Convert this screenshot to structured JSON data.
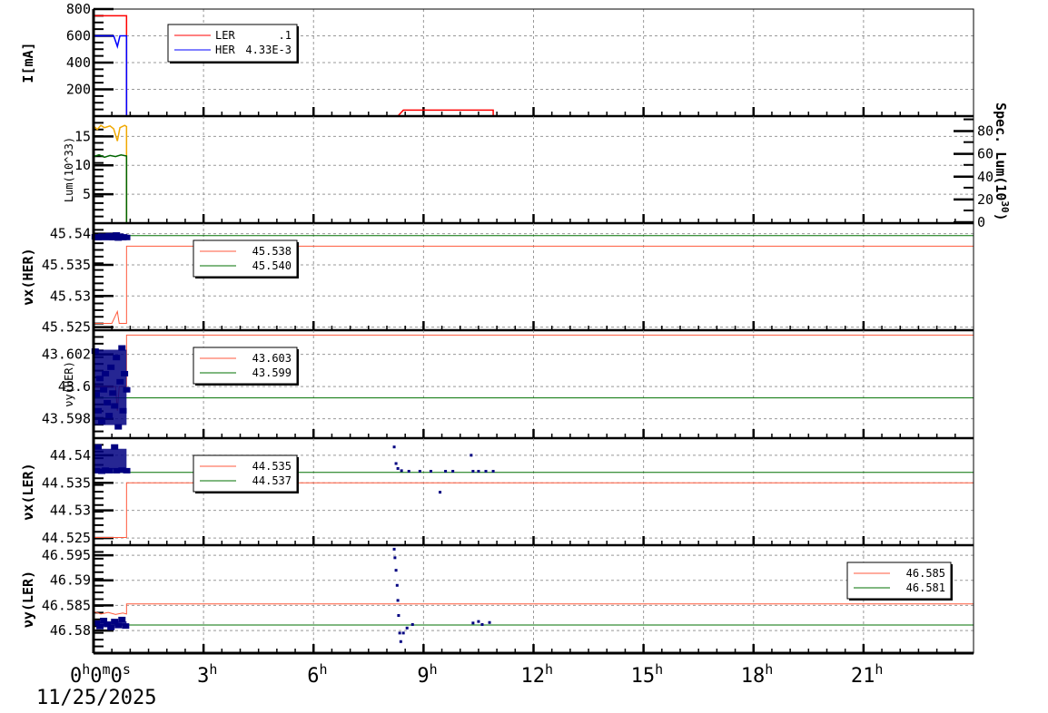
{
  "chart_data": [
    {
      "type": "line",
      "ylabel": "I[mA]",
      "ylim": [
        0,
        800
      ],
      "yticks": [
        200,
        400,
        600,
        800
      ],
      "ytick_labels": [
        "200",
        "400",
        "600",
        "800"
      ],
      "legend": {
        "placement": "top-left",
        "entries": [
          {
            "name": "LER",
            "value": ".1",
            "color": "#ff0000"
          },
          {
            "name": "HER",
            "value": "4.33E-3",
            "color": "#0000ff"
          }
        ]
      },
      "series": [
        {
          "name": "LER",
          "color": "#ff0000",
          "points": [
            [
              0,
              750
            ],
            [
              0.9,
              750
            ],
            [
              0.9,
              0
            ],
            [
              8.3,
              0
            ],
            [
              8.45,
              45
            ],
            [
              10.9,
              45
            ],
            [
              10.9,
              0
            ],
            [
              24,
              0
            ]
          ]
        },
        {
          "name": "HER",
          "color": "#0000ff",
          "points": [
            [
              0,
              600
            ],
            [
              0.55,
              600
            ],
            [
              0.65,
              520
            ],
            [
              0.72,
              600
            ],
            [
              0.9,
              600
            ],
            [
              0.9,
              0
            ],
            [
              24,
              0
            ]
          ]
        }
      ]
    },
    {
      "type": "line",
      "ylabel": "Lum(10^33)",
      "ylim": [
        0,
        18.5
      ],
      "yticks": [
        5,
        10,
        15
      ],
      "ytick_labels": [
        "5",
        "10",
        "15"
      ],
      "y2label": "Spec. Lum(10^30)",
      "y2lim": [
        0,
        90
      ],
      "y2ticks": [
        0,
        20,
        40,
        60,
        80
      ],
      "y2tick_labels": [
        "0",
        "20",
        "40",
        "60",
        "80"
      ],
      "series": [
        {
          "name": "Lum",
          "color": "#f0a800",
          "points": [
            [
              0,
              16.8
            ],
            [
              0.1,
              16.2
            ],
            [
              0.2,
              16.9
            ],
            [
              0.3,
              16.5
            ],
            [
              0.45,
              16.8
            ],
            [
              0.55,
              16.3
            ],
            [
              0.65,
              14.2
            ],
            [
              0.72,
              16.5
            ],
            [
              0.85,
              16.9
            ],
            [
              0.9,
              16.7
            ],
            [
              0.9,
              0
            ]
          ]
        },
        {
          "name": "Spec. Lum",
          "color": "#006400",
          "points": [
            [
              0,
              11.5
            ],
            [
              0.15,
              11.8
            ],
            [
              0.3,
              11.4
            ],
            [
              0.45,
              11.7
            ],
            [
              0.6,
              11.5
            ],
            [
              0.75,
              11.8
            ],
            [
              0.9,
              11.6
            ],
            [
              0.9,
              0
            ]
          ]
        }
      ]
    },
    {
      "type": "scatter",
      "ylabel": "νx(HER)",
      "ylim": [
        45.5245,
        45.5417
      ],
      "yticks": [
        45.525,
        45.53,
        45.535,
        45.54
      ],
      "ytick_labels": [
        "45.525",
        "45.53",
        "45.535",
        "45.54"
      ],
      "legend": {
        "placement": "top-left",
        "entries": [
          {
            "name": "",
            "value": "45.538",
            "color": "#ff5a3c"
          },
          {
            "name": "",
            "value": "45.540",
            "color": "#007000"
          }
        ]
      },
      "series": [
        {
          "name": "set",
          "color": "#ff5a3c",
          "points": [
            [
              0,
              45.5256
            ],
            [
              0.5,
              45.5256
            ],
            [
              0.65,
              45.5275
            ],
            [
              0.7,
              45.5256
            ],
            [
              0.9,
              45.5256
            ],
            [
              0.9,
              45.538
            ],
            [
              24,
              45.538
            ]
          ]
        },
        {
          "name": "ref",
          "color": "#007000",
          "points": [
            [
              0,
              45.5397
            ],
            [
              24,
              45.5397
            ]
          ]
        },
        {
          "name": "meas",
          "color": "#000080",
          "dots": [
            [
              0.02,
              45.5395
            ],
            [
              0.1,
              45.5394
            ],
            [
              0.2,
              45.5396
            ],
            [
              0.3,
              45.5395
            ],
            [
              0.4,
              45.5397
            ],
            [
              0.5,
              45.5394
            ],
            [
              0.6,
              45.5398
            ],
            [
              0.65,
              45.5393
            ],
            [
              0.7,
              45.5396
            ],
            [
              0.8,
              45.5395
            ],
            [
              0.88,
              45.5394
            ]
          ]
        }
      ]
    },
    {
      "type": "scatter",
      "ylabel": "νy(HER)",
      "ylim": [
        43.5968,
        43.6035
      ],
      "yticks": [
        43.598,
        43.6,
        43.602
      ],
      "ytick_labels": [
        "43.598",
        "43.6",
        "43.602"
      ],
      "legend": {
        "placement": "top-left",
        "entries": [
          {
            "name": "",
            "value": "43.603",
            "color": "#ff5a3c"
          },
          {
            "name": "",
            "value": "43.599",
            "color": "#007000"
          }
        ]
      },
      "series": [
        {
          "name": "set",
          "color": "#ff5a3c",
          "points": [
            [
              0,
              43.6
            ],
            [
              0.6,
              43.6
            ],
            [
              0.65,
              43.5985
            ],
            [
              0.7,
              43.6
            ],
            [
              0.9,
              43.6
            ],
            [
              0.9,
              43.6032
            ],
            [
              24,
              43.6032
            ]
          ]
        },
        {
          "name": "ref",
          "color": "#007000",
          "points": [
            [
              0,
              43.5993
            ],
            [
              24,
              43.5993
            ]
          ]
        },
        {
          "name": "meas",
          "color": "#000080",
          "dots": [
            [
              0.02,
              43.6022
            ],
            [
              0.05,
              43.5995
            ],
            [
              0.1,
              43.5985
            ],
            [
              0.15,
              43.6005
            ],
            [
              0.2,
              43.5978
            ],
            [
              0.25,
              43.5998
            ],
            [
              0.3,
              43.6008
            ],
            [
              0.35,
              43.599
            ],
            [
              0.4,
              43.5982
            ],
            [
              0.45,
              43.6012
            ],
            [
              0.5,
              43.5996
            ],
            [
              0.55,
              43.5988
            ],
            [
              0.6,
              43.6018
            ],
            [
              0.65,
              43.5975
            ],
            [
              0.7,
              43.6003
            ],
            [
              0.75,
              43.6024
            ],
            [
              0.78,
              43.5985
            ],
            [
              0.82,
              43.6008
            ],
            [
              0.88,
              43.5998
            ]
          ]
        }
      ]
    },
    {
      "type": "scatter",
      "ylabel": "νx(LER)",
      "ylim": [
        44.5237,
        44.5431
      ],
      "yticks": [
        44.525,
        44.53,
        44.535,
        44.54
      ],
      "ytick_labels": [
        "44.525",
        "44.53",
        "44.535",
        "44.54"
      ],
      "legend": {
        "placement": "top-left",
        "entries": [
          {
            "name": "",
            "value": "44.535",
            "color": "#ff5a3c"
          },
          {
            "name": "",
            "value": "44.537",
            "color": "#007000"
          }
        ]
      },
      "series": [
        {
          "name": "set",
          "color": "#ff5a3c",
          "points": [
            [
              0,
              44.5251
            ],
            [
              0.9,
              44.5251
            ],
            [
              0.9,
              44.535
            ],
            [
              24,
              44.535
            ]
          ]
        },
        {
          "name": "ref",
          "color": "#007000",
          "points": [
            [
              0,
              44.5369
            ],
            [
              24,
              44.5369
            ]
          ]
        },
        {
          "name": "meas",
          "color": "#000080",
          "dots": [
            [
              0.05,
              44.5372
            ],
            [
              0.1,
              44.5415
            ],
            [
              0.2,
              44.5371
            ],
            [
              0.3,
              44.5373
            ],
            [
              0.4,
              44.5372
            ],
            [
              0.55,
              44.5415
            ],
            [
              0.6,
              44.5372
            ],
            [
              0.75,
              44.5373
            ],
            [
              0.88,
              44.5372
            ],
            [
              8.2,
              44.5415
            ],
            [
              8.25,
              44.5385
            ],
            [
              8.3,
              44.5376
            ],
            [
              8.4,
              44.5372
            ],
            [
              8.6,
              44.5371
            ],
            [
              8.9,
              44.5371
            ],
            [
              9.2,
              44.5371
            ],
            [
              9.45,
              44.5333
            ],
            [
              9.6,
              44.5371
            ],
            [
              9.8,
              44.5371
            ],
            [
              10.3,
              44.54
            ],
            [
              10.35,
              44.5371
            ],
            [
              10.5,
              44.5371
            ],
            [
              10.7,
              44.5371
            ],
            [
              10.9,
              44.5371
            ]
          ]
        }
      ]
    },
    {
      "type": "scatter",
      "ylabel": "νy(LER)",
      "ylim": [
        46.5755,
        46.597
      ],
      "yticks": [
        46.58,
        46.585,
        46.59,
        46.595
      ],
      "ytick_labels": [
        "46.58",
        "46.585",
        "46.59",
        "46.595"
      ],
      "legend": {
        "placement": "top-right",
        "entries": [
          {
            "name": "",
            "value": "46.585",
            "color": "#ff5a3c"
          },
          {
            "name": "",
            "value": "46.581",
            "color": "#007000"
          }
        ]
      },
      "series": [
        {
          "name": "set",
          "color": "#ff5a3c",
          "points": [
            [
              0,
              46.5838
            ],
            [
              0.2,
              46.5833
            ],
            [
              0.4,
              46.5836
            ],
            [
              0.6,
              46.5832
            ],
            [
              0.8,
              46.5835
            ],
            [
              0.9,
              46.5833
            ],
            [
              0.9,
              46.5853
            ],
            [
              24,
              46.5853
            ]
          ]
        },
        {
          "name": "ref",
          "color": "#007000",
          "points": [
            [
              0,
              46.5811
            ],
            [
              24,
              46.5811
            ]
          ]
        },
        {
          "name": "meas",
          "color": "#000080",
          "dots": [
            [
              0.05,
              46.5815
            ],
            [
              0.15,
              46.5808
            ],
            [
              0.25,
              46.582
            ],
            [
              0.35,
              46.5812
            ],
            [
              0.45,
              46.5806
            ],
            [
              0.55,
              46.5818
            ],
            [
              0.65,
              46.581
            ],
            [
              0.75,
              46.5822
            ],
            [
              0.85,
              46.5809
            ],
            [
              8.2,
              46.5962
            ],
            [
              8.22,
              46.5945
            ],
            [
              8.25,
              46.592
            ],
            [
              8.28,
              46.589
            ],
            [
              8.3,
              46.586
            ],
            [
              8.32,
              46.583
            ],
            [
              8.35,
              46.5795
            ],
            [
              8.38,
              46.5778
            ],
            [
              8.45,
              46.5795
            ],
            [
              8.55,
              46.5805
            ],
            [
              8.7,
              46.5812
            ],
            [
              10.35,
              46.5815
            ],
            [
              10.5,
              46.5818
            ],
            [
              10.6,
              46.5812
            ],
            [
              10.8,
              46.5816
            ]
          ]
        }
      ]
    }
  ],
  "x_axis": {
    "range_hours": [
      0,
      24
    ],
    "ticks": [
      {
        "hours": 0,
        "label": "0",
        "sup": "h",
        "label2": "0",
        "sup2": "m",
        "label3": "0",
        "sup3": "s"
      },
      {
        "hours": 3,
        "label": "3",
        "sup": "h"
      },
      {
        "hours": 6,
        "label": "6",
        "sup": "h"
      },
      {
        "hours": 9,
        "label": "9",
        "sup": "h"
      },
      {
        "hours": 12,
        "label": "12",
        "sup": "h"
      },
      {
        "hours": 15,
        "label": "15",
        "sup": "h"
      },
      {
        "hours": 18,
        "label": "18",
        "sup": "h"
      },
      {
        "hours": 21,
        "label": "21",
        "sup": "h"
      }
    ],
    "date": "11/25/2025"
  }
}
